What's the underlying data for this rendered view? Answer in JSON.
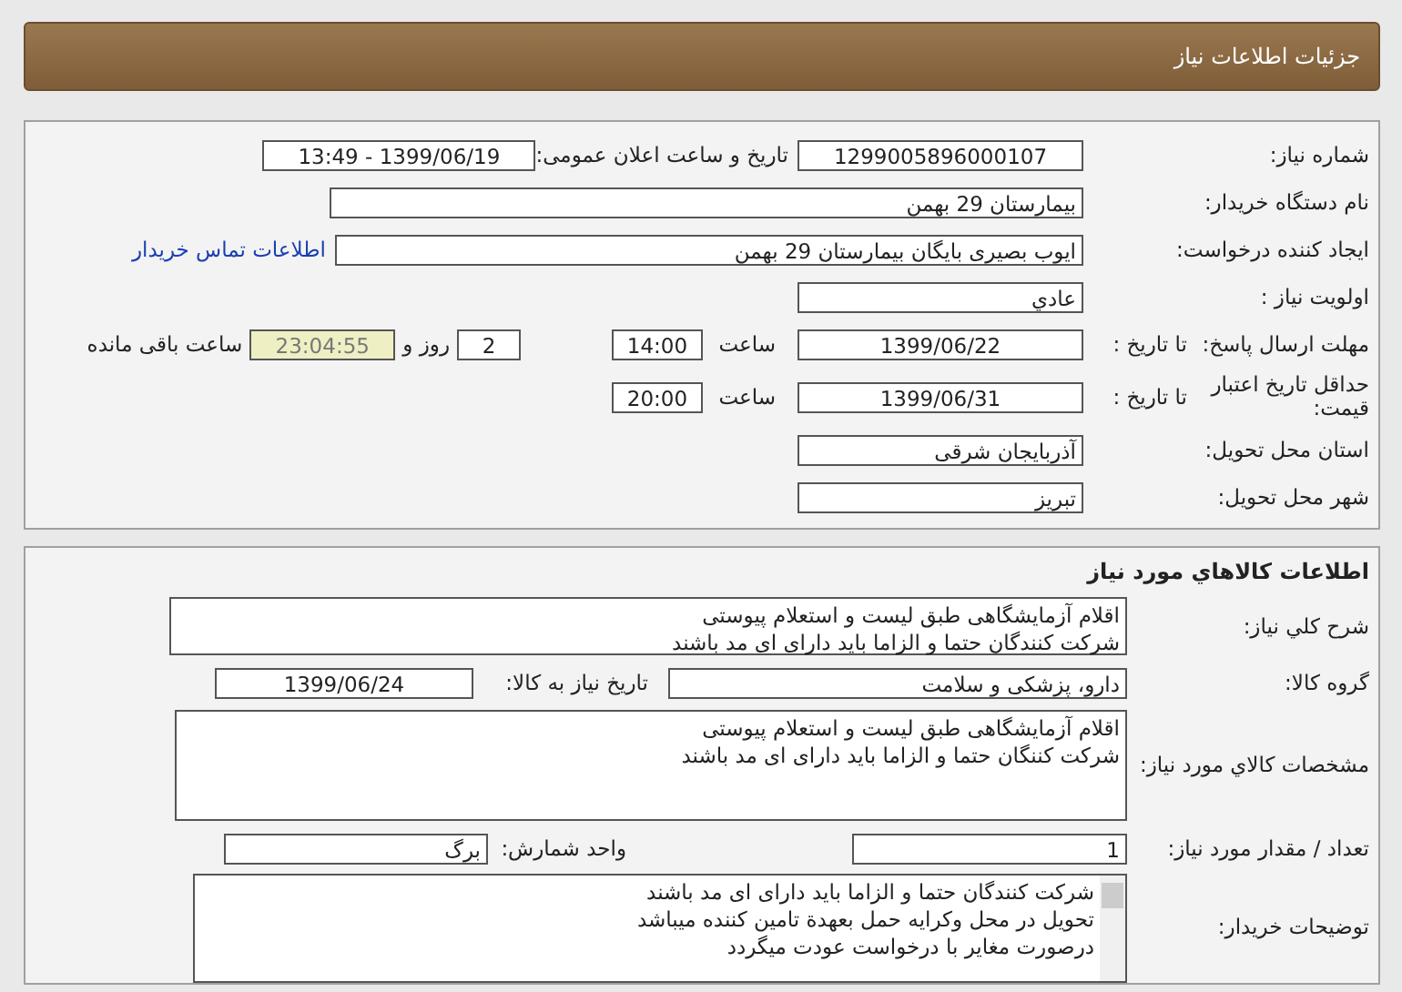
{
  "header": {
    "title": "جزئیات اطلاعات نیاز"
  },
  "need_info": {
    "need_number_label": "شماره نیاز:",
    "need_number": "1299005896000107",
    "announce_label": "تاریخ و ساعت اعلان عمومی:",
    "announce_datetime": "1399/06/19 - 13:49",
    "buyer_org_label": "نام دستگاه خریدار:",
    "buyer_org": "بیمارستان 29 بهمن",
    "creator_label": "ایجاد کننده درخواست:",
    "creator": "ایوب بصیری  بایگان بیمارستان 29 بهمن",
    "contact_link": "اطلاعات تماس خریدار",
    "priority_label": "اولویت نیاز :",
    "priority": "عادي",
    "reply_deadline": {
      "label": "مهلت ارسال پاسخ:",
      "until_label": "تا تاریخ :",
      "date": "1399/06/22",
      "time_label": "ساعت",
      "time": "14:00",
      "days": "2",
      "days_suffix": "روز و",
      "remaining": "23:04:55",
      "remaining_label": "ساعت باقی مانده"
    },
    "price_validity": {
      "label": "حداقل تاریخ اعتبار قیمت:",
      "until_label": "تا تاریخ :",
      "date": "1399/06/31",
      "time_label": "ساعت",
      "time": "20:00"
    },
    "province_label": "استان محل تحویل:",
    "province": "آذربایجان شرقی",
    "city_label": "شهر محل تحویل:",
    "city": "تبریز"
  },
  "goods_info": {
    "title": "اطلاعات کالاهاي مورد نياز",
    "summary_label": "شرح کلي نیاز:",
    "summary_lines": [
      "اقلام آزمایشگاهی طبق لیست و استعلام پیوستی",
      "شرکت کنندگان حتما و الزاما باید دارای ای مد باشند"
    ],
    "group_label": "گروه کالا:",
    "group": "دارو، پزشکی و سلامت",
    "need_date_label": "تاریخ نیاز به کالا:",
    "need_date": "1399/06/24",
    "spec_label": "مشخصات کالاي مورد نياز:",
    "spec_lines": [
      "اقلام آزمایشگاهی طبق لیست و استعلام پیوستی",
      "شرکت کننگان حتما و الزاما باید دارای ای مد باشند"
    ],
    "qty_label": "تعداد / مقدار مورد نیاز:",
    "qty": "1",
    "unit_label": "واحد شمارش:",
    "unit": "برگ",
    "notes_label": "توضیحات خریدار:",
    "notes_lines": [
      "شرکت کنندگان حتما و الزاما باید دارای ای مد باشند",
      "تحویل در محل وکرایه حمل بعهدة تامین کننده میباشد",
      "درصورت مغایر با درخواست عودت میگردد"
    ]
  }
}
